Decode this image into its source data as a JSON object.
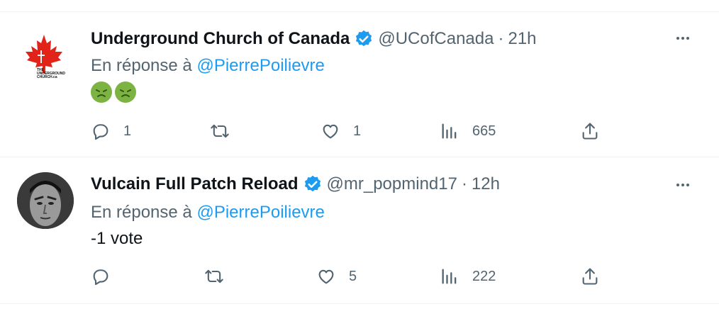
{
  "tweets": [
    {
      "author": "Underground Church of Canada",
      "handle": "@UCofCanada",
      "separator": "·",
      "time": "21h",
      "reply_prefix": "En réponse à",
      "reply_mention": "@PierrePoilievre",
      "text": "",
      "emojis": [
        "nauseated-face",
        "nauseated-face"
      ],
      "logo_text": "THE UNDERGROUND CHURCH.ca",
      "actions": {
        "replies": "1",
        "retweets": "",
        "likes": "1",
        "views": "665"
      }
    },
    {
      "author": "Vulcain Full Patch Reload",
      "handle": "@mr_popmind17",
      "separator": "·",
      "time": "12h",
      "reply_prefix": "En réponse à",
      "reply_mention": "@PierrePoilievre",
      "text": "-1 vote",
      "actions": {
        "replies": "",
        "retweets": "",
        "likes": "5",
        "views": "222"
      }
    }
  ],
  "colors": {
    "accent": "#1d9bf0",
    "secondary_text": "#536471",
    "divider": "#eff3f4",
    "maple_red": "#e2231a"
  },
  "icons": [
    "maple-leaf-icon",
    "verified-badge-icon",
    "more-icon",
    "reply-icon",
    "retweet-icon",
    "like-icon",
    "views-icon",
    "share-icon"
  ]
}
